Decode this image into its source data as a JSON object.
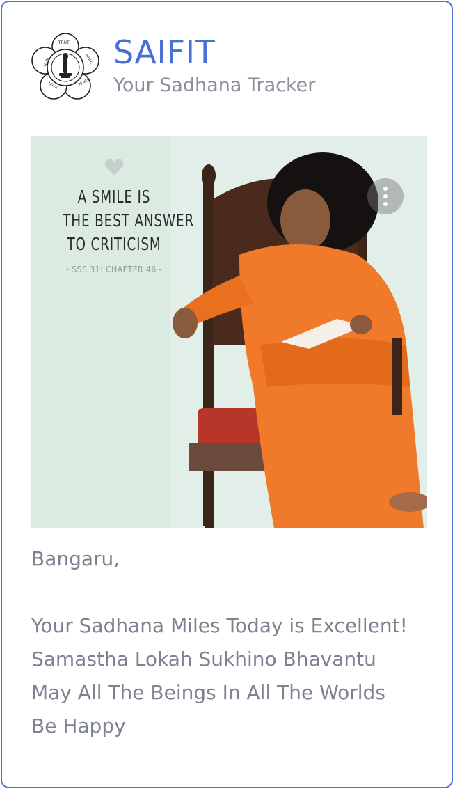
{
  "app": {
    "title": "SAIFIT",
    "subtitle": "Your Sadhana Tracker",
    "logo_icon": "lotus-emblem-icon",
    "logo_petals": [
      "TRUTH",
      "RIGHT CONDUCT",
      "PEACE",
      "LOVE",
      "NON VIOLENCE"
    ]
  },
  "hero": {
    "quote_lines": [
      "A SMILE IS",
      "THE BEST ANSWER",
      "TO CRITICISM"
    ],
    "source": "- SSS 31: CHAPTER 46 -",
    "icons": [
      "heart-icon",
      "more-vertical-icon"
    ]
  },
  "message": {
    "greeting": "Bangaru,",
    "lines": [
      "Your Sadhana Miles Today is Excellent!",
      "Samastha Lokah Sukhino Bhavantu",
      "May All The Beings In All The Worlds",
      "Be Happy"
    ]
  },
  "colors": {
    "accent": "#4a6fd4",
    "border": "#4a74d6",
    "text": "#7d8291",
    "robe": "#f07a2a"
  }
}
